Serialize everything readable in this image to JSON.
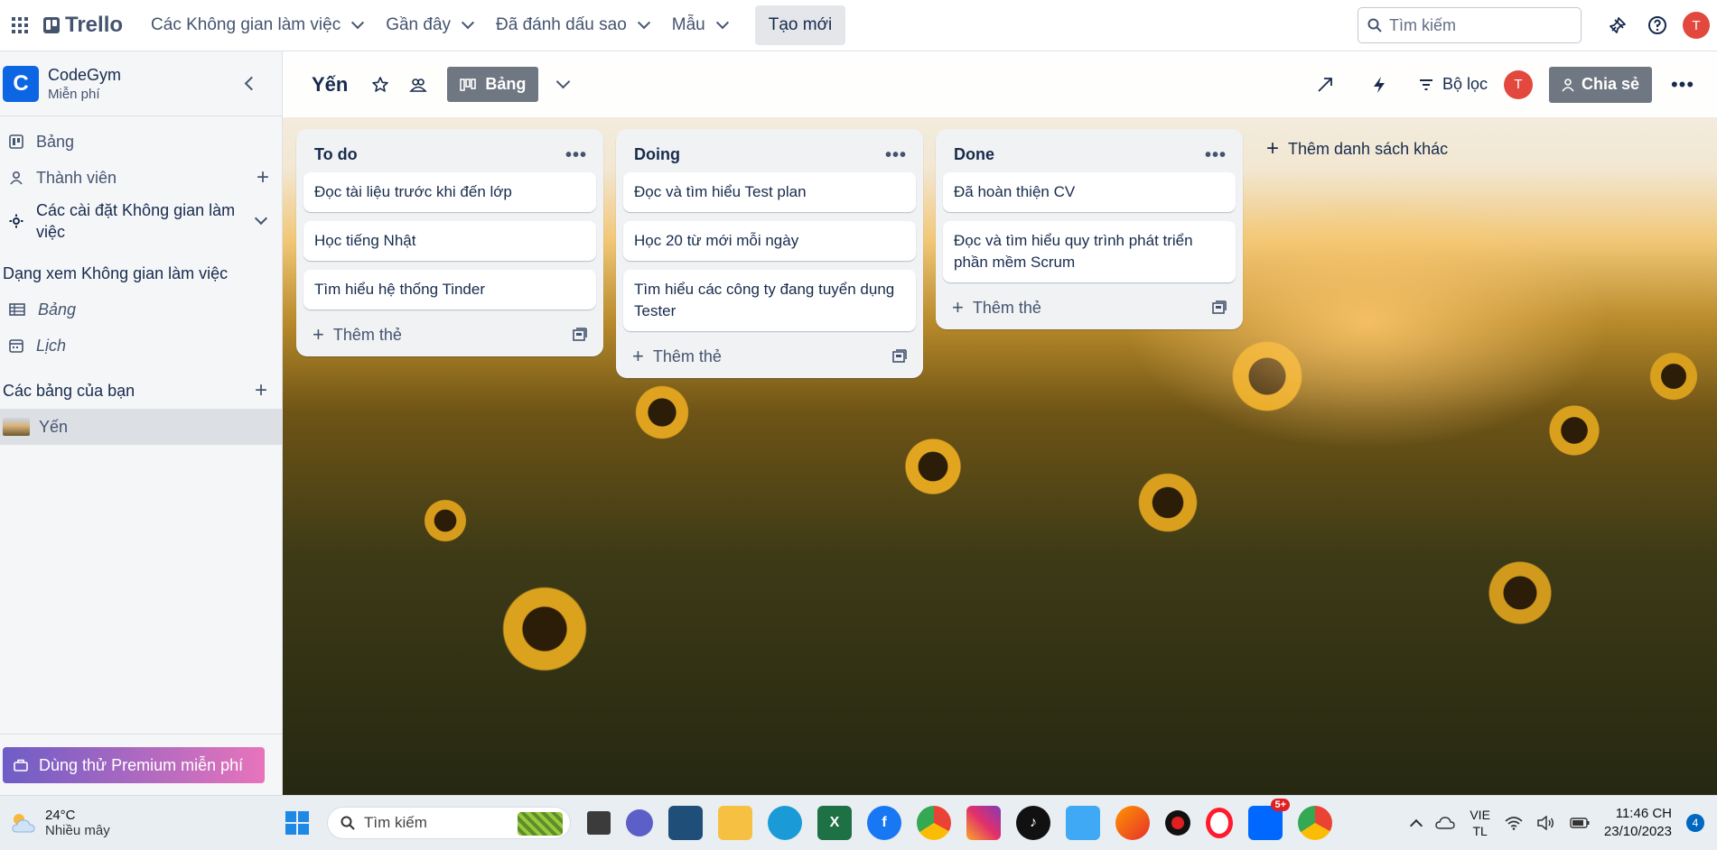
{
  "nav": {
    "logo": "Trello",
    "items": [
      {
        "label": "Các Không gian làm việc"
      },
      {
        "label": "Gần đây"
      },
      {
        "label": "Đã đánh dấu sao"
      },
      {
        "label": "Mẫu"
      }
    ],
    "create": "Tạo mới",
    "search_placeholder": "Tìm kiếm",
    "avatar_initial": "T"
  },
  "sidebar": {
    "workspace_initial": "C",
    "workspace_name": "CodeGym",
    "workspace_plan": "Miễn phí",
    "items": [
      {
        "label": "Bảng"
      },
      {
        "label": "Thành viên"
      },
      {
        "label": "Các cài đặt Không gian làm việc"
      }
    ],
    "views_title": "Dạng xem Không gian làm việc",
    "views": [
      {
        "label": "Bảng"
      },
      {
        "label": "Lịch"
      }
    ],
    "boards_title": "Các bảng của bạn",
    "boards": [
      {
        "label": "Yến"
      }
    ],
    "premium": "Dùng thử Premium miễn phí"
  },
  "board": {
    "title": "Yến",
    "view_label": "Bảng",
    "filter_label": "Bộ lọc",
    "avatar_initial": "T",
    "share_label": "Chia sẻ",
    "add_list": "Thêm danh sách khác",
    "lists": [
      {
        "title": "To do",
        "cards": [
          "Đọc tài liệu trước khi đến lớp",
          "Học tiếng Nhật",
          "Tìm hiểu hệ thống Tinder"
        ],
        "add": "Thêm thẻ"
      },
      {
        "title": "Doing",
        "cards": [
          "Đọc và tìm hiểu Test plan",
          "Học 20 từ mới mỗi ngày",
          "Tìm hiểu các công ty đang tuyển dụng Tester"
        ],
        "add": "Thêm thẻ"
      },
      {
        "title": "Done",
        "cards": [
          "Đã hoàn thiện CV",
          "Đọc và tìm hiểu quy trình phát triển phần mềm Scrum"
        ],
        "add": "Thêm thẻ"
      }
    ]
  },
  "taskbar": {
    "temperature": "24°C",
    "weather": "Nhiều mây",
    "search": "Tìm kiếm",
    "lang_top": "VIE",
    "lang_bottom": "TL",
    "time": "11:46 CH",
    "date": "23/10/2023",
    "notifications": "4",
    "zalo_badge": "5+"
  },
  "colors": {
    "accent": "#0c66e4",
    "avatar": "#e2483d",
    "share_button": "#6f7782",
    "premium_start": "#6e5dc6",
    "premium_end": "#e774bb"
  }
}
